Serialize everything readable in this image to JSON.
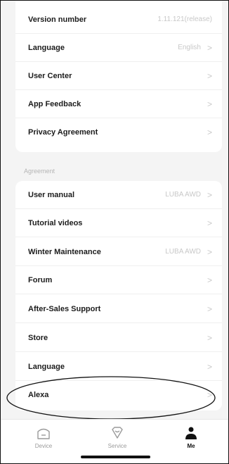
{
  "settings": {
    "version": {
      "label": "Version number",
      "value": "1.11.121(release)"
    },
    "language": {
      "label": "Language",
      "value": "English"
    },
    "user_center": {
      "label": "User Center"
    },
    "app_feedback": {
      "label": "App Feedback"
    },
    "privacy": {
      "label": "Privacy Agreement"
    }
  },
  "agreement_section": {
    "title": "Agreement"
  },
  "agreement": {
    "user_manual": {
      "label": "User manual",
      "value": "LUBA AWD"
    },
    "tutorial_videos": {
      "label": "Tutorial videos"
    },
    "winter_maintenance": {
      "label": "Winter Maintenance",
      "value": "LUBA AWD"
    },
    "forum": {
      "label": "Forum"
    },
    "after_sales": {
      "label": "After-Sales Support"
    },
    "store": {
      "label": "Store"
    },
    "language": {
      "label": "Language"
    },
    "alexa": {
      "label": "Alexa"
    }
  },
  "chevron": ">",
  "tabbar": {
    "device": {
      "label": "Device",
      "icon": "device-icon"
    },
    "service": {
      "label": "Service",
      "icon": "service-icon"
    },
    "me": {
      "label": "Me",
      "icon": "person-icon"
    }
  },
  "colors": {
    "accent": "#111111",
    "muted": "#c8c8c8",
    "background": "#f4f4f4"
  }
}
